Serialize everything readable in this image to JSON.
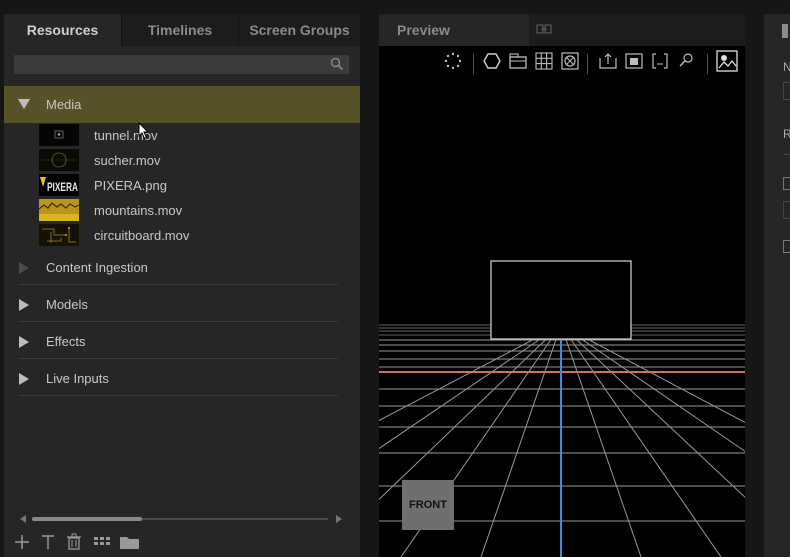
{
  "resources": {
    "tabs": [
      {
        "label": "Resources",
        "active": true
      },
      {
        "label": "Timelines",
        "active": false
      },
      {
        "label": "Screen Groups",
        "active": false
      }
    ],
    "search": {
      "value": "",
      "placeholder": ""
    },
    "media_folder": {
      "label": "Media",
      "expanded": true
    },
    "files": [
      {
        "name": "tunnel.mov",
        "thumb": "tunnel-thumb"
      },
      {
        "name": "sucher.mov",
        "thumb": "sucher-thumb"
      },
      {
        "name": "PIXERA.png",
        "thumb": "pixera-logo-thumb"
      },
      {
        "name": "mountains.mov",
        "thumb": "mountains-thumb"
      },
      {
        "name": "circuitboard.mov",
        "thumb": "circuitboard-thumb"
      }
    ],
    "folders": [
      {
        "label": "Content Ingestion",
        "enabled": false
      },
      {
        "label": "Models",
        "enabled": true
      },
      {
        "label": "Effects",
        "enabled": true
      },
      {
        "label": "Live Inputs",
        "enabled": true
      }
    ],
    "toolbar_icons": [
      "add-icon",
      "text-icon",
      "trash-icon",
      "grid-icon",
      "folder-icon"
    ]
  },
  "preview": {
    "tab_label": "Preview",
    "toolbar_icons": [
      "loading-icon",
      "hexagon-icon",
      "layers-icon",
      "grid-icon",
      "target-icon",
      "export-icon",
      "screen-icon",
      "crop-icon",
      "search-icon",
      "view-toggle-icon"
    ],
    "front_label": "FRONT",
    "colors": {
      "grid": "#9a9a9a",
      "horizon_line": "#d07060",
      "axis_line": "#3b8fd8",
      "viewport_bg": "#000000"
    }
  },
  "right_panel": {
    "partial_labels": [
      "N",
      "R"
    ]
  },
  "colors": {
    "accent": "#585228",
    "panel": "#262626",
    "background": "#161616"
  }
}
